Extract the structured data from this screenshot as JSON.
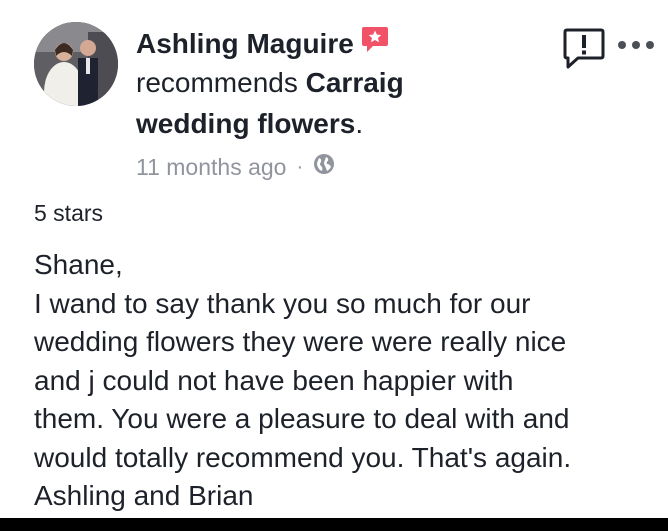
{
  "post": {
    "author": "Ashling Maguire",
    "verb": "recommends",
    "page_name_part1": "Carraig",
    "page_name_part2": "wedding flowers",
    "page_name_suffix": ".",
    "timestamp": "11 months ago",
    "separator": "·",
    "privacy_icon": "globe-icon",
    "badge_icon": "recommendation-badge-icon",
    "rating": "5 stars",
    "review_lines": [
      "Shane,",
      "I wand to say thank you so much for our",
      "wedding flowers they were were really nice",
      "and j could not have been happier with",
      "them. You were a pleasure to deal with and",
      "would totally recommend you. That's again.",
      "Ashling and Brian"
    ]
  },
  "actions": {
    "report_icon": "report-icon",
    "more_icon": "more-options-icon"
  },
  "colors": {
    "text": "#1d2129",
    "meta": "#90949c",
    "badge": "#f25268"
  }
}
